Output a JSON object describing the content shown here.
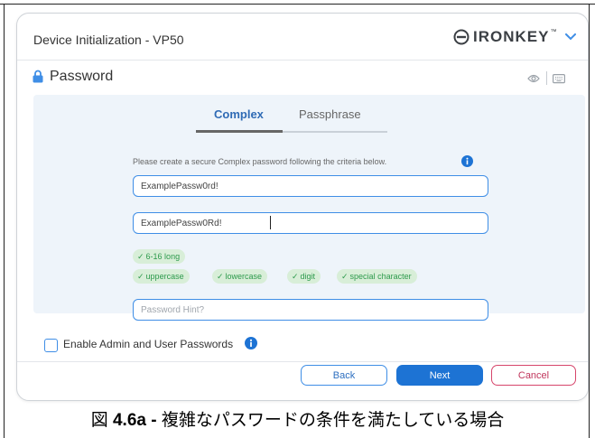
{
  "window": {
    "title": "Device Initialization - VP50",
    "brand": "IRONKEY",
    "brand_tm": "™"
  },
  "section": {
    "title": "Password"
  },
  "tabs": [
    {
      "label": "Complex",
      "active": true
    },
    {
      "label": "Passphrase",
      "active": false
    }
  ],
  "form": {
    "instructions": "Please create a secure Complex password following the criteria below.",
    "password_value": "ExamplePassw0rd!",
    "confirm_value": "ExamplePassw0Rd!",
    "hint_placeholder": "Password Hint?"
  },
  "criteria": [
    {
      "label": "6-16 long"
    },
    {
      "label": "uppercase"
    },
    {
      "label": "lowercase"
    },
    {
      "label": "digit"
    },
    {
      "label": "special character"
    }
  ],
  "options": {
    "admin_user_label": "Enable Admin and User Passwords",
    "admin_user_checked": false
  },
  "buttons": {
    "back": "Back",
    "next": "Next",
    "cancel": "Cancel"
  },
  "caption": {
    "prefix": "図",
    "figure_number": "4.6a",
    "separator": "-",
    "text": "複雑なパスワードの条件を満たしている場合"
  },
  "icons": {
    "logo": "ironkey-logo-icon",
    "menu": "chevron-down-icon",
    "lock": "lock-icon",
    "show_password": "eye-icon",
    "keyboard": "keyboard-icon",
    "info": "info-icon",
    "check": "check-icon"
  },
  "colors": {
    "accent_blue": "#1d73d4",
    "success_green": "#2d9a4c",
    "success_bg": "#d8eed8",
    "cancel_red": "#d6456b",
    "panel_bg": "#eef4fa"
  }
}
